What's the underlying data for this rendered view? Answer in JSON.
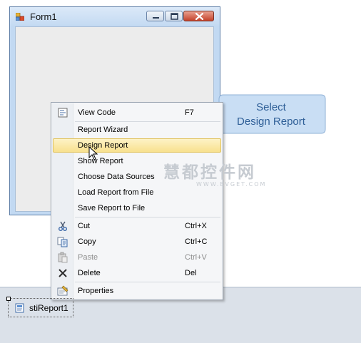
{
  "form": {
    "title": "Form1"
  },
  "context_menu": {
    "items": [
      {
        "label": "View Code",
        "shortcut": "F7",
        "icon": "view-code-icon"
      },
      {
        "label": "Report Wizard"
      },
      {
        "label": "Design Report",
        "highlighted": true
      },
      {
        "label": "Show Report"
      },
      {
        "label": "Choose Data Sources"
      },
      {
        "label": "Load Report from File"
      },
      {
        "label": "Save Report to File"
      },
      {
        "label": "Cut",
        "shortcut": "Ctrl+X",
        "icon": "scissors-icon"
      },
      {
        "label": "Copy",
        "shortcut": "Ctrl+C",
        "icon": "copy-icon"
      },
      {
        "label": "Paste",
        "shortcut": "Ctrl+V",
        "icon": "paste-icon",
        "disabled": true
      },
      {
        "label": "Delete",
        "shortcut": "Del",
        "icon": "delete-icon"
      },
      {
        "label": "Properties",
        "icon": "properties-icon"
      }
    ]
  },
  "callout": {
    "line1": "Select",
    "line2": "Design Report"
  },
  "component_tray": {
    "component_label": "stiReport1"
  },
  "watermark": {
    "big": "慧都控件网",
    "small": "WWW.EVGET.COM"
  },
  "colors": {
    "menu_highlight": "#f8e18e",
    "callout_fill": "#c9def4",
    "callout_text": "#2f5f97",
    "close_button": "#c4422b"
  }
}
